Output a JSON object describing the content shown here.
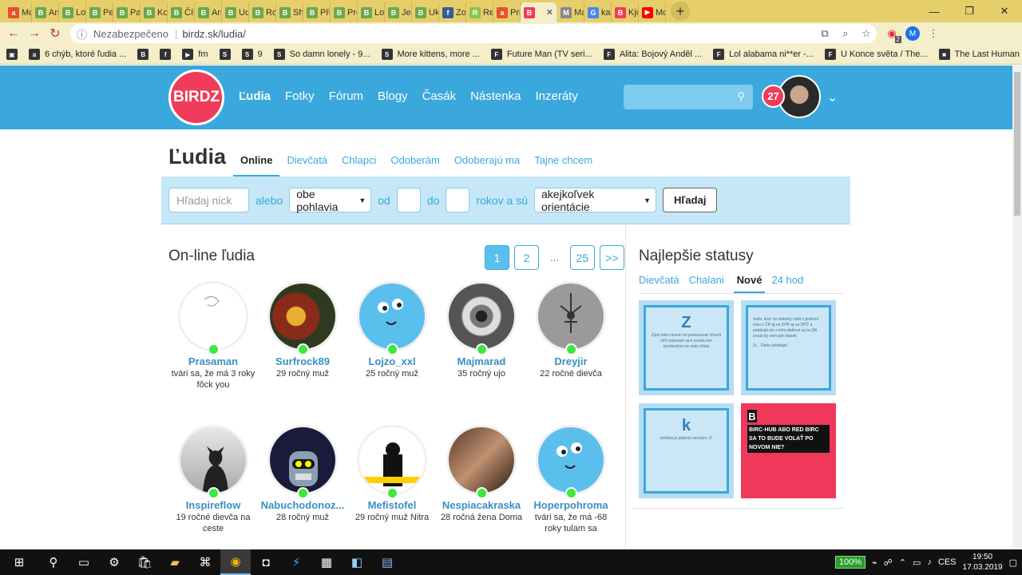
{
  "browser": {
    "tabs": [
      {
        "icon": "a",
        "color": "#e8502c",
        "title": "Mc"
      },
      {
        "icon": "B",
        "color": "#6aa84f",
        "title": "An"
      },
      {
        "icon": "B",
        "color": "#6aa84f",
        "title": "Lov"
      },
      {
        "icon": "B",
        "color": "#6aa84f",
        "title": "Pet"
      },
      {
        "icon": "B",
        "color": "#6aa84f",
        "title": "Par"
      },
      {
        "icon": "B",
        "color": "#6aa84f",
        "title": "Kor"
      },
      {
        "icon": "B",
        "color": "#6aa84f",
        "title": "Čís"
      },
      {
        "icon": "B",
        "color": "#6aa84f",
        "title": "Arr"
      },
      {
        "icon": "B",
        "color": "#6aa84f",
        "title": "Ud"
      },
      {
        "icon": "B",
        "color": "#6aa84f",
        "title": "Rol"
      },
      {
        "icon": "B",
        "color": "#6aa84f",
        "title": "Shr"
      },
      {
        "icon": "B",
        "color": "#6aa84f",
        "title": "Pře"
      },
      {
        "icon": "B",
        "color": "#6aa84f",
        "title": "Pre"
      },
      {
        "icon": "B",
        "color": "#6aa84f",
        "title": "Lov"
      },
      {
        "icon": "B",
        "color": "#6aa84f",
        "title": "Jed"
      },
      {
        "icon": "B",
        "color": "#6aa84f",
        "title": "Uk"
      },
      {
        "icon": "f",
        "color": "#3b5998",
        "title": "Zo"
      },
      {
        "icon": "R",
        "color": "#8bc34a",
        "title": "Re"
      },
      {
        "icon": "a",
        "color": "#e8502c",
        "title": "Pri"
      },
      {
        "icon": "B",
        "color": "#f03c5a",
        "title": "",
        "active": true
      },
      {
        "icon": "M",
        "color": "#888888",
        "title": "Ma"
      },
      {
        "icon": "G",
        "color": "#4285f4",
        "title": "kar"
      },
      {
        "icon": "B",
        "color": "#f03c5a",
        "title": "Kju"
      },
      {
        "icon": "▶",
        "color": "#ff0000",
        "title": "Mc"
      }
    ],
    "security_label": "Nezabezpečeno",
    "url": "birdz.sk/ludia/",
    "ext_badge": "2",
    "profile_initial": "M",
    "bookmarks": [
      {
        "icon": "▣",
        "label": ""
      },
      {
        "icon": "a",
        "label": "6 chýb, ktoré ľudia ..."
      },
      {
        "icon": "B",
        "label": ""
      },
      {
        "icon": "f",
        "label": ""
      },
      {
        "icon": "▶",
        "label": "fm"
      },
      {
        "icon": "S",
        "label": ""
      },
      {
        "icon": "S",
        "label": "9"
      },
      {
        "icon": "S",
        "label": "So damn lonely - 9..."
      },
      {
        "icon": "S",
        "label": "More kittens, more ..."
      },
      {
        "icon": "F",
        "label": "Future Man (TV seri..."
      },
      {
        "icon": "F",
        "label": "Alita: Bojový Anděl ..."
      },
      {
        "icon": "F",
        "label": "Lol alabama ni**er -..."
      },
      {
        "icon": "F",
        "label": "U Konce světa / The..."
      },
      {
        "icon": "■",
        "label": "The Last Human 12..."
      }
    ]
  },
  "site": {
    "logo": "BIRDZ",
    "nav": [
      "Ľudia",
      "Fotky",
      "Fórum",
      "Blogy",
      "Časák",
      "Nástenka",
      "Inzeráty"
    ],
    "notifications": "27",
    "accent": "#3aa8dd",
    "brand_red": "#f03c5a"
  },
  "page": {
    "title": "Ľudia",
    "tabs": [
      "Online",
      "Dievčatá",
      "Chlapci",
      "Odoberám",
      "Odoberajú ma",
      "Tajne chcem"
    ]
  },
  "filter": {
    "nick_placeholder": "Hľadaj nick",
    "or": "alebo",
    "gender": "obe pohlavia",
    "from": "od",
    "to": "do",
    "years": "rokov a sú",
    "orientation": "akejkoľvek orientácie",
    "search": "Hľadaj"
  },
  "online": {
    "title": "On-line ľudia",
    "pages": [
      "1",
      "2",
      "...",
      "25",
      ">>"
    ],
    "users": [
      {
        "name": "Prasaman",
        "info": "tvári sa, že má 3 roky fŏck you",
        "avatar": "sketch"
      },
      {
        "name": "Surfrock89",
        "info": "29 ročný muž",
        "avatar": "painting"
      },
      {
        "name": "Lojzo_xxl",
        "info": "25 ročný muž",
        "avatar": "face"
      },
      {
        "name": "Majmarad",
        "info": "35 ročný ujo",
        "avatar": "eye"
      },
      {
        "name": "Dreyjir",
        "info": "22 ročné dievča",
        "avatar": "symbol"
      },
      {
        "name": "Inspireflow",
        "info": "19 ročné dievča na ceste",
        "avatar": "silhouette"
      },
      {
        "name": "Nabuchodonoz...",
        "info": "28 ročný muž",
        "avatar": "robot"
      },
      {
        "name": "Mefistofel",
        "info": "29 ročný muž Nitra",
        "avatar": "acta"
      },
      {
        "name": "Nespiacakraska",
        "info": "28 ročná žena Doma",
        "avatar": "photo"
      },
      {
        "name": "Hoperpohroma",
        "info": "tvári sa, že má -68 roky tulam sa",
        "avatar": "face"
      }
    ]
  },
  "statuses": {
    "title": "Najlepšie statusy",
    "tabs": [
      "Dievčatá",
      "Chalani",
      "Nové",
      "24 hod"
    ],
    "cards": [
      {
        "big": "Z",
        "text": "Zjem lebo musim ne prekusovať chcem učit nepozam sa k zoostu ket predsedom na malu chela"
      },
      {
        "big": "",
        "text": "ľudia, ktorí sa niekedy robili v jednom roku v ČR aj na DPP aj na DPČ a podávali ste z toho daňové aj na SR. zrada by som pár otázok",
        "reply": "Zr... Daňa zvládaje!"
      },
      {
        "big": "k",
        "text": "kolieba je platený sensizm :D"
      },
      {
        "red": true,
        "text": "BIRC-HUB ABO RED BIRC SA TO BUDE VOLAŤ PO NOVOM NIE?"
      }
    ]
  },
  "taskbar": {
    "battery": "100%",
    "lang": "CES",
    "time": "19:50",
    "date": "17.03.2019"
  }
}
